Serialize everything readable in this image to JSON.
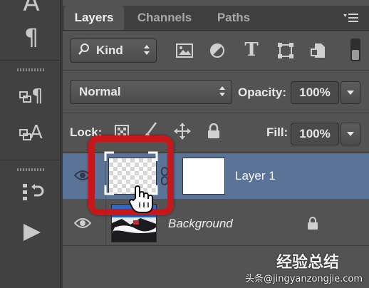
{
  "panel": {
    "tabs": [
      {
        "label": "Layers",
        "active": true
      },
      {
        "label": "Channels",
        "active": false
      },
      {
        "label": "Paths",
        "active": false
      }
    ],
    "filter": {
      "label": "Kind"
    },
    "blend_mode": {
      "value": "Normal"
    },
    "opacity": {
      "label": "Opacity:",
      "value": "100%"
    },
    "lock": {
      "label": "Lock:"
    },
    "fill": {
      "label": "Fill:",
      "value": "100%"
    }
  },
  "layers": [
    {
      "name": "Layer 1",
      "selected": true,
      "visible": true,
      "has_mask": true
    },
    {
      "name": "Background",
      "selected": false,
      "visible": true,
      "locked": true
    }
  ],
  "watermark": {
    "line1": "经验总结",
    "line2": "头条@jingyanzongjie.com"
  },
  "colors": {
    "panel": "#535353",
    "tabbar": "#3f3f3f",
    "selected_row": "#5b7396",
    "highlight_ring": "#c8171b"
  }
}
